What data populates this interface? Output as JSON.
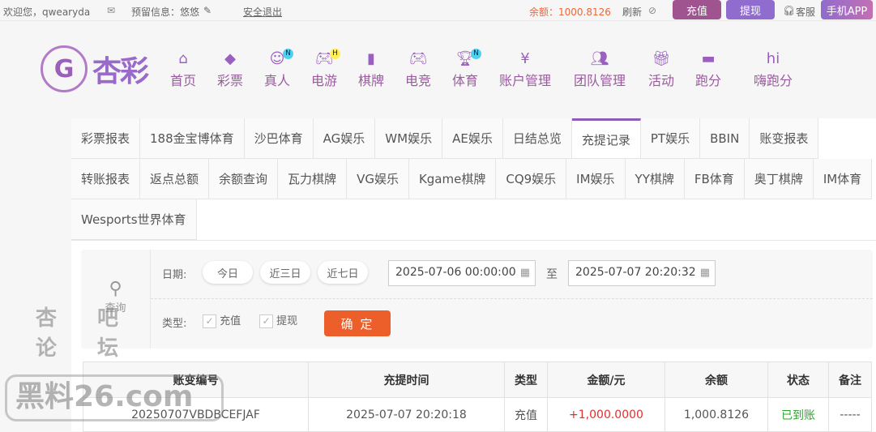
{
  "topbar": {
    "welcome": "欢迎您，qwearyda",
    "message_label": "预留信息：悠悠",
    "logout": "安全退出",
    "balance": "余额：1000.8126",
    "refresh": "刷新",
    "recharge": "充值",
    "withdraw": "提现",
    "service": "客服",
    "app": "手机APP"
  },
  "logo": {
    "text": "杏彩"
  },
  "nav": [
    {
      "label": "首页",
      "icon": "home-icon"
    },
    {
      "label": "彩票",
      "icon": "ticket-icon"
    },
    {
      "label": "真人",
      "icon": "dealer-icon",
      "badge": "N"
    },
    {
      "label": "电游",
      "icon": "gamepad-icon",
      "badge": "H"
    },
    {
      "label": "棋牌",
      "icon": "cards-icon"
    },
    {
      "label": "电竞",
      "icon": "gamepad-icon"
    },
    {
      "label": "体育",
      "icon": "trophy-icon",
      "badge": "N"
    },
    {
      "label": "账户管理",
      "icon": "yen-icon"
    },
    {
      "label": "团队管理",
      "icon": "team-icon"
    },
    {
      "label": "活动",
      "icon": "gift-icon"
    },
    {
      "label": "跑分",
      "icon": "rhino-icon"
    },
    {
      "label": "嗨跑分",
      "icon": "hi-icon"
    }
  ],
  "tabs": [
    "彩票报表",
    "188金宝博体育",
    "沙巴体育",
    "AG娱乐",
    "WM娱乐",
    "AE娱乐",
    "日结总览",
    "充提记录",
    "PT娱乐",
    "BBIN",
    "账变报表",
    "转账报表",
    "返点总额",
    "余额查询",
    "瓦力棋牌",
    "VG娱乐",
    "Kgame棋牌",
    "CQ9娱乐",
    "IM娱乐",
    "YY棋牌",
    "FB体育",
    "奥丁棋牌",
    "IM体育",
    "Wesports世界体育"
  ],
  "active_tab": "充提记录",
  "filter": {
    "query": "查询",
    "date_label": "日期:",
    "today": "今日",
    "three_days": "近三日",
    "seven_days": "近七日",
    "start": "2025-07-06 00:00:00",
    "to": "至",
    "end": "2025-07-07 20:20:32",
    "type_label": "类型:",
    "recharge": "充值",
    "withdraw": "提现",
    "confirm": "确 定"
  },
  "table": {
    "headers": [
      "账变编号",
      "充提时间",
      "类型",
      "金额/元",
      "余额",
      "状态",
      "备注"
    ],
    "rows": [
      [
        "20250707VBDBCEFJAF",
        "2025-07-07 20:20:18",
        "充值",
        "+1,000.0000",
        "1,000.8126",
        "已到账",
        "-----"
      ]
    ]
  },
  "watermark": {
    "line1": "杏吧 论坛",
    "line2": "黑料26.com"
  },
  "colors": {
    "accent": "#8e5bb5",
    "confirm": "#ec5f2b",
    "amount": "#e03030",
    "status": "#2ea52e"
  }
}
